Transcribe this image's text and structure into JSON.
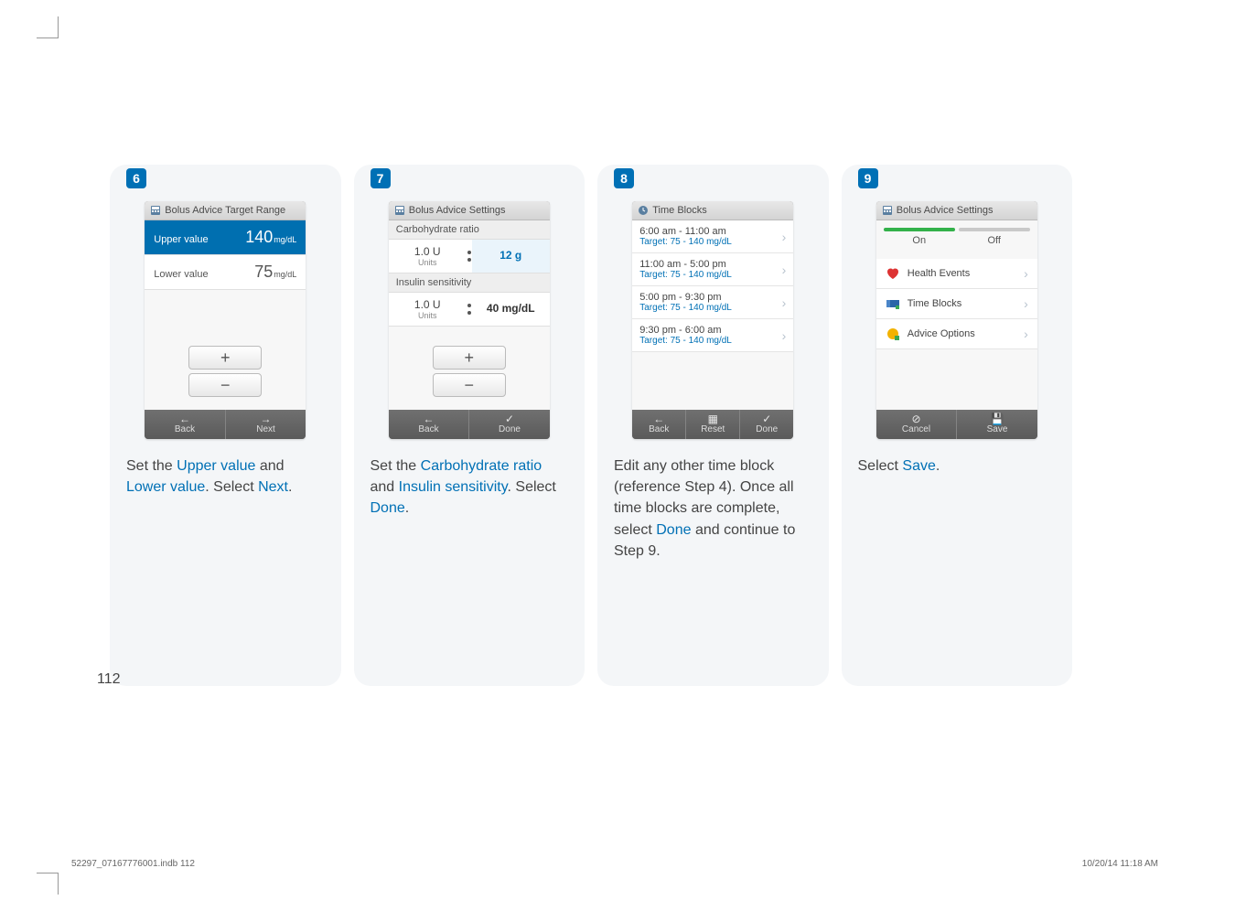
{
  "page_number": "112",
  "print": {
    "jobref": "52297_07167776001.indb   112",
    "datetime": "10/20/14   11:18 AM"
  },
  "steps": [
    {
      "num": "6",
      "phone": {
        "header": "Bolus Advice Target Range",
        "rows": [
          {
            "label": "Upper value",
            "value": "140",
            "unit": "mg/dL",
            "selected": true
          },
          {
            "label": "Lower value",
            "value": "75",
            "unit": "mg/dL",
            "selected": false
          }
        ],
        "footer": [
          {
            "icon": "←",
            "label": "Back"
          },
          {
            "icon": "→",
            "label": "Next"
          }
        ]
      },
      "caption_parts": [
        {
          "t": "Set the "
        },
        {
          "t": "Upper value",
          "hl": true
        },
        {
          "t": " and "
        },
        {
          "t": "Lower value",
          "hl": true
        },
        {
          "t": ". Select "
        },
        {
          "t": "Next",
          "hl": true
        },
        {
          "t": "."
        }
      ]
    },
    {
      "num": "7",
      "phone": {
        "header": "Bolus Advice Settings",
        "sections": [
          {
            "label": "Carbohydrate ratio",
            "left_value": "1.0 U",
            "left_unit": "Units",
            "right_value": "12 g",
            "right_accent": true
          },
          {
            "label": "Insulin sensitivity",
            "left_value": "1.0 U",
            "left_unit": "Units",
            "right_value": "40 mg/dL",
            "right_accent": false
          }
        ],
        "footer": [
          {
            "icon": "←",
            "label": "Back"
          },
          {
            "icon": "✓",
            "label": "Done"
          }
        ]
      },
      "caption_parts": [
        {
          "t": "Set the "
        },
        {
          "t": "Carbohydrate ratio",
          "hl": true
        },
        {
          "t": " and "
        },
        {
          "t": "Insulin sensitivity",
          "hl": true
        },
        {
          "t": ". Select "
        },
        {
          "t": "Done",
          "hl": true
        },
        {
          "t": "."
        }
      ]
    },
    {
      "num": "8",
      "phone": {
        "header": "Time Blocks",
        "rows": [
          {
            "line1": "6:00 am - 11:00 am",
            "line2": "Target: 75 - 140 mg/dL"
          },
          {
            "line1": "11:00 am - 5:00 pm",
            "line2": "Target: 75 - 140 mg/dL"
          },
          {
            "line1": "5:00 pm - 9:30 pm",
            "line2": "Target: 75 - 140 mg/dL"
          },
          {
            "line1": "9:30 pm - 6:00 am",
            "line2": "Target: 75 - 140 mg/dL"
          }
        ],
        "footer": [
          {
            "icon": "←",
            "label": "Back"
          },
          {
            "icon": "▦",
            "label": "Reset"
          },
          {
            "icon": "✓",
            "label": "Done"
          }
        ]
      },
      "caption_parts": [
        {
          "t": "Edit any other time block (reference Step 4). Once all time blocks are complete, select "
        },
        {
          "t": "Done",
          "hl": true
        },
        {
          "t": " and continue to Step 9."
        }
      ]
    },
    {
      "num": "9",
      "phone": {
        "header": "Bolus Advice Settings",
        "toggle": {
          "on": "On",
          "off": "Off"
        },
        "rows": [
          {
            "icon": "heart",
            "label": "Health Events"
          },
          {
            "icon": "blocks",
            "label": "Time Blocks"
          },
          {
            "icon": "advice",
            "label": "Advice Options"
          }
        ],
        "footer": [
          {
            "icon": "⊘",
            "label": "Cancel"
          },
          {
            "icon": "💾",
            "label": "Save"
          }
        ]
      },
      "caption_parts": [
        {
          "t": "Select "
        },
        {
          "t": "Save",
          "hl": true
        },
        {
          "t": "."
        }
      ]
    }
  ]
}
